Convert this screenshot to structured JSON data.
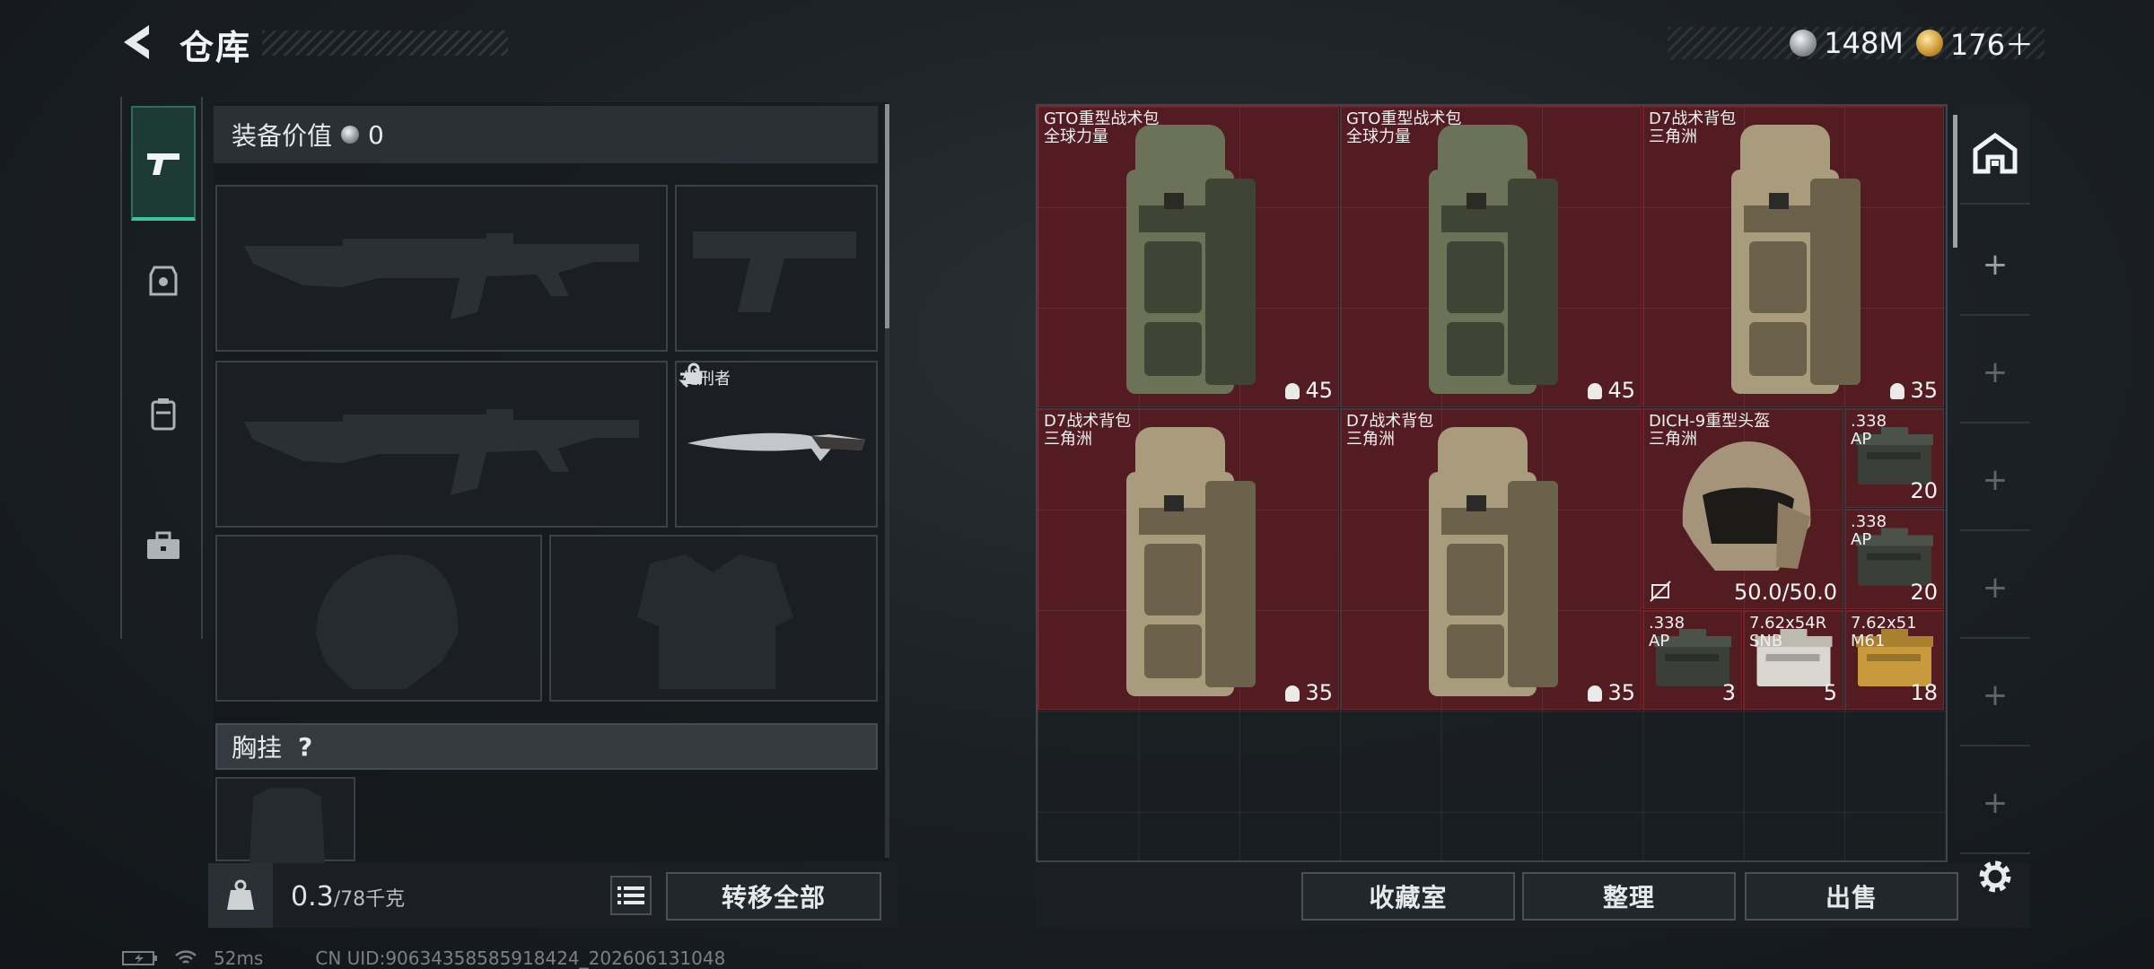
{
  "header": {
    "title": "仓库",
    "currency": [
      {
        "name": "silver-coin-icon",
        "value": "148M"
      },
      {
        "name": "gold-coin-icon",
        "value": "176＋"
      }
    ]
  },
  "left_tabs": [
    "pistol-icon",
    "armor-icon",
    "backpack-icon",
    "toolbox-icon"
  ],
  "equipment": {
    "value_label": "装备价值",
    "value": "0",
    "melee_label": "处刑者",
    "chest_label": "胸挂",
    "chest_help": "?"
  },
  "footer_left": {
    "weight_current": "0.3",
    "weight_max": "/78千克",
    "transfer_all": "转移全部"
  },
  "stash": {
    "items": [
      {
        "name": "GTO重型战术包\n全球力量",
        "count": "45",
        "type": "backpack-green"
      },
      {
        "name": "GTO重型战术包\n全球力量",
        "count": "45",
        "type": "backpack-green"
      },
      {
        "name": "D7战术背包\n三角洲",
        "count": "35",
        "type": "backpack-tan"
      },
      {
        "name": "D7战术背包\n三角洲",
        "count": "35",
        "type": "backpack-tan"
      },
      {
        "name": "D7战术背包\n三角洲",
        "count": "35",
        "type": "backpack-tan"
      },
      {
        "name": "DICH-9重型头盔\n三角洲",
        "count": "50.0/50.0",
        "type": "helmet"
      },
      {
        "name": ".338\nAP",
        "count": "20",
        "type": "ammo-box"
      },
      {
        "name": ".338\nAP",
        "count": "20",
        "type": "ammo-box"
      },
      {
        "name": ".338\nAP",
        "count": "3",
        "type": "ammo-box"
      },
      {
        "name": "7.62x54R\nSNB",
        "count": "5",
        "type": "ammo-white"
      },
      {
        "name": "7.62x51\nM61",
        "count": "18",
        "type": "ammo-yellow"
      }
    ]
  },
  "right_tabs": [
    "stash-home-icon",
    "+",
    "+",
    "+",
    "+",
    "+",
    "+"
  ],
  "footer_right": {
    "collection": "收藏室",
    "sort": "整理",
    "sell": "出售"
  },
  "status": {
    "ping": "52ms",
    "uid": "CN UID:90634358585918424_202606131048"
  }
}
